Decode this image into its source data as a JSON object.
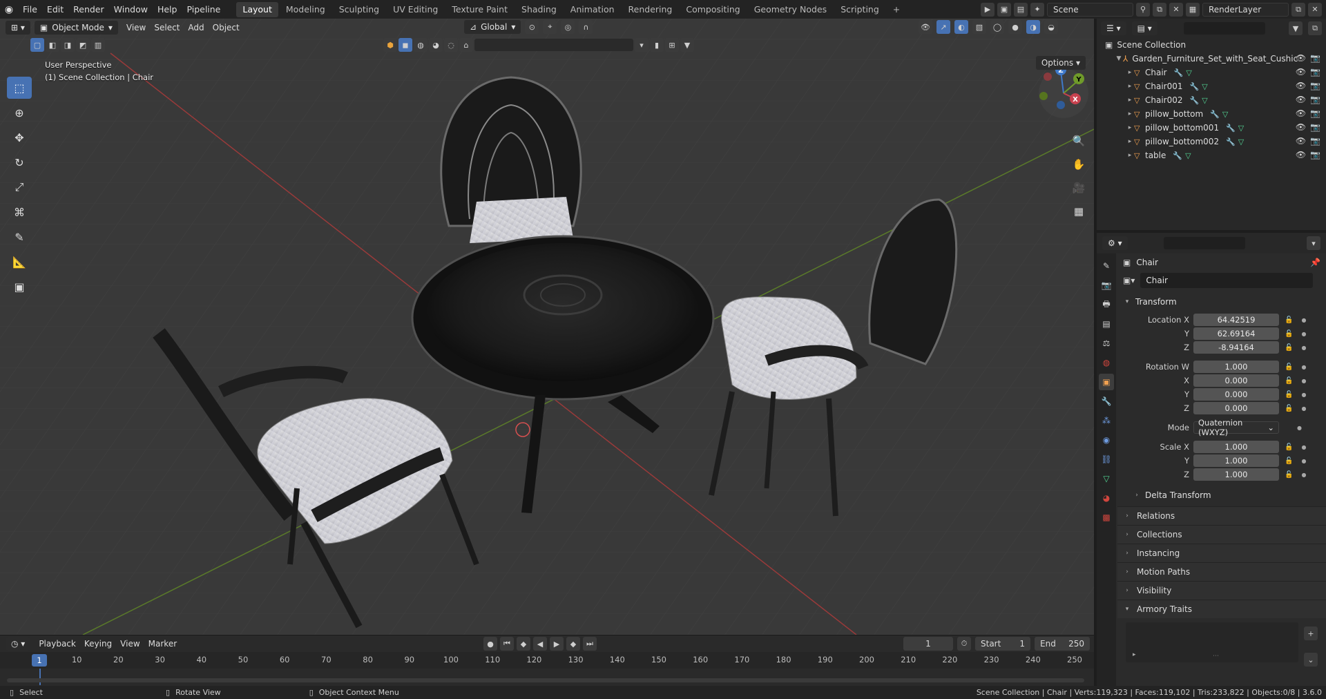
{
  "topbar": {
    "menus": [
      "File",
      "Edit",
      "Render",
      "Window",
      "Help",
      "Pipeline"
    ],
    "workspaces": [
      "Layout",
      "Modeling",
      "Sculpting",
      "UV Editing",
      "Texture Paint",
      "Shading",
      "Animation",
      "Rendering",
      "Compositing",
      "Geometry Nodes",
      "Scripting"
    ],
    "active_workspace": "Layout",
    "add_workspace": "+",
    "scene_name": "Scene",
    "view_layer": "RenderLayer"
  },
  "viewport": {
    "mode": "Object Mode",
    "menus": [
      "View",
      "Select",
      "Add",
      "Object"
    ],
    "orientation": "Global",
    "options_label": "Options",
    "info_line1": "User Perspective",
    "info_line2": "(1) Scene Collection | Chair",
    "gizmo": {
      "x": "X",
      "y": "Y",
      "z": "Z"
    }
  },
  "outliner": {
    "root": "Scene Collection",
    "collection": "Garden_Furniture_Set_with_Seat_Cushic",
    "objects": [
      "Chair",
      "Chair001",
      "Chair002",
      "pillow_bottom",
      "pillow_bottom001",
      "pillow_bottom002",
      "table"
    ]
  },
  "properties": {
    "object_title": "Chair",
    "object_name": "Chair",
    "transform_label": "Transform",
    "location": {
      "label": "Location X",
      "x": "64.42519",
      "y": "62.69164",
      "z": "-8.94164"
    },
    "rotation": {
      "label": "Rotation W",
      "w": "1.000",
      "x": "0.000",
      "y": "0.000",
      "z": "0.000"
    },
    "mode_label": "Mode",
    "mode_value": "Quaternion (WXYZ)",
    "scale": {
      "label": "Scale X",
      "x": "1.000",
      "y": "1.000",
      "z": "1.000"
    },
    "axis_labels": {
      "y": "Y",
      "z": "Z",
      "x": "X"
    },
    "delta_transform": "Delta Transform",
    "panels": [
      "Relations",
      "Collections",
      "Instancing",
      "Motion Paths",
      "Visibility"
    ],
    "armory_traits": "Armory Traits"
  },
  "timeline": {
    "menus": [
      "Playback",
      "Keying",
      "View",
      "Marker"
    ],
    "current_frame": "1",
    "start_label": "Start",
    "start_value": "1",
    "end_label": "End",
    "end_value": "250",
    "ticks": [
      "1",
      "10",
      "20",
      "30",
      "40",
      "50",
      "60",
      "70",
      "80",
      "90",
      "100",
      "110",
      "120",
      "130",
      "140",
      "150",
      "160",
      "170",
      "180",
      "190",
      "200",
      "210",
      "220",
      "230",
      "240",
      "250"
    ]
  },
  "statusbar": {
    "select": "Select",
    "rotate": "Rotate View",
    "context": "Object Context Menu",
    "stats": "Scene Collection | Chair | Verts:119,323 | Faces:119,102 | Tris:233,822 | Objects:0/8 | 3.6.0"
  }
}
